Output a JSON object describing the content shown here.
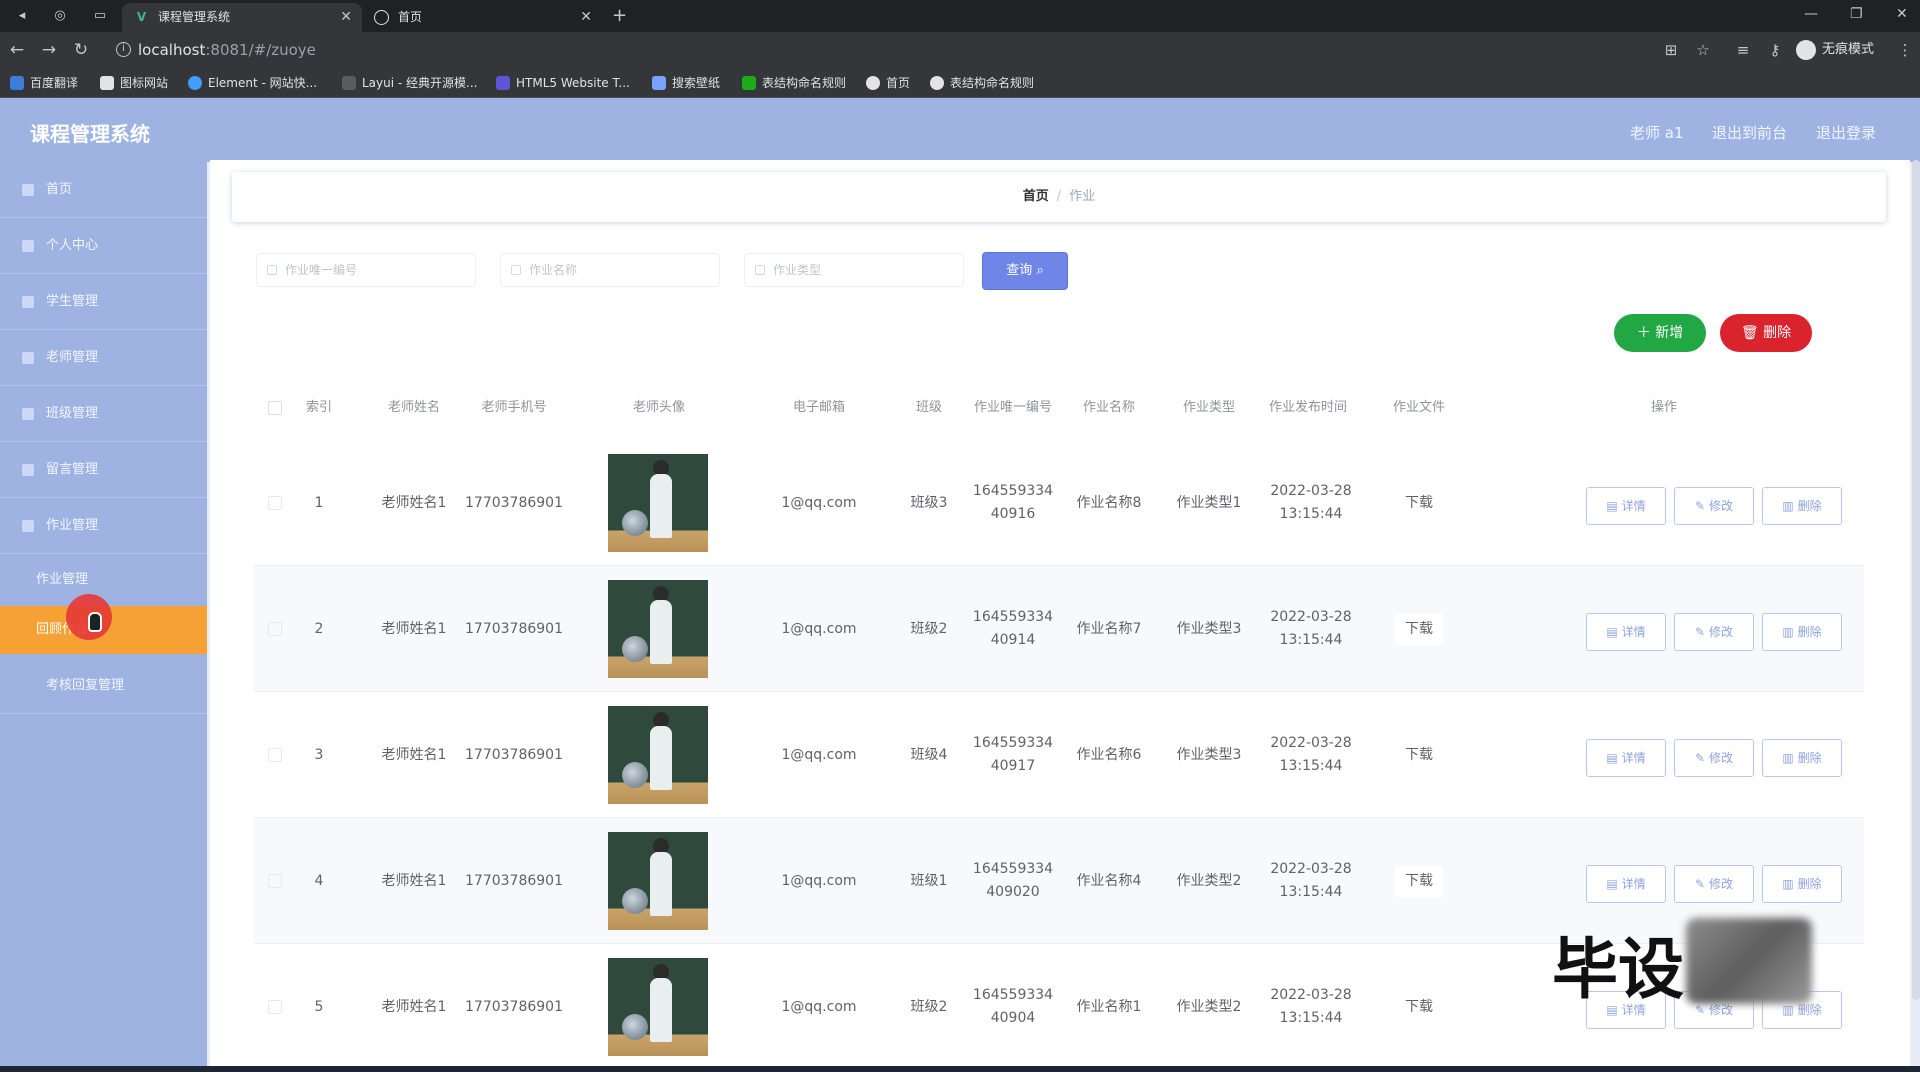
{
  "browser": {
    "tabs": [
      {
        "title": "课程管理系统",
        "active": true
      },
      {
        "title": "首页",
        "active": false
      }
    ],
    "url_host": "localhost",
    "url_rest": ":8081/#/zuoye",
    "incognito_label": "无痕模式",
    "bookmarks": [
      "百度翻译",
      "图标网站",
      "Element - 网站快...",
      "Layui - 经典开源模...",
      "HTML5 Website T...",
      "搜索壁纸",
      "表结构命名规则",
      "首页",
      "表结构命名规则"
    ]
  },
  "app": {
    "title": "课程管理系统",
    "header_links": [
      "老师 a1",
      "退出到前台",
      "退出登录"
    ]
  },
  "sidebar": {
    "items": [
      "首页",
      "个人中心",
      "学生管理",
      "老师管理",
      "班级管理",
      "留言管理",
      "作业管理"
    ],
    "sub_items": [
      "作业管理",
      "回顾作业"
    ],
    "after_items": [
      "考核回复管理"
    ],
    "active": "回顾作业"
  },
  "breadcrumb": {
    "home": "首页",
    "sep": "/",
    "current": "作业"
  },
  "filters": [
    {
      "placeholder": "作业唯一编号"
    },
    {
      "placeholder": "作业名称"
    },
    {
      "placeholder": "作业类型"
    }
  ],
  "buttons": {
    "query": "查询",
    "add": "新增",
    "delete": "删除"
  },
  "table": {
    "columns": [
      "索引",
      "老师姓名",
      "老师手机号",
      "老师头像",
      "电子邮箱",
      "班级",
      "作业唯一编号",
      "作业名称",
      "作业类型",
      "作业发布时间",
      "作业文件",
      "操作"
    ],
    "rows": [
      {
        "index": "1",
        "teacher": "老师姓名1",
        "phone": "17703786901",
        "email": "1@qq.com",
        "class": "班级3",
        "code": "164559334 40916",
        "name": "作业名称8",
        "type": "作业类型1",
        "date": "2022-03-28",
        "time": "13:15:44",
        "file": "下载"
      },
      {
        "index": "2",
        "teacher": "老师姓名1",
        "phone": "17703786901",
        "email": "1@qq.com",
        "class": "班级2",
        "code": "164559334 40914",
        "name": "作业名称7",
        "type": "作业类型3",
        "date": "2022-03-28",
        "time": "13:15:44",
        "file": "下载"
      },
      {
        "index": "3",
        "teacher": "老师姓名1",
        "phone": "17703786901",
        "email": "1@qq.com",
        "class": "班级4",
        "code": "164559334 40917",
        "name": "作业名称6",
        "type": "作业类型3",
        "date": "2022-03-28",
        "time": "13:15:44",
        "file": "下载"
      },
      {
        "index": "4",
        "teacher": "老师姓名1",
        "phone": "17703786901",
        "email": "1@qq.com",
        "class": "班级1",
        "code": "164559334 409020",
        "name": "作业名称4",
        "type": "作业类型2",
        "date": "2022-03-28",
        "time": "13:15:44",
        "file": "下载"
      },
      {
        "index": "5",
        "teacher": "老师姓名1",
        "phone": "17703786901",
        "email": "1@qq.com",
        "class": "班级2",
        "code": "164559334 40904",
        "name": "作业名称1",
        "type": "作业类型2",
        "date": "2022-03-28",
        "time": "13:15:44",
        "file": "下载"
      }
    ],
    "row_actions": [
      "详情",
      "修改",
      "删除"
    ]
  },
  "watermark": "毕设"
}
